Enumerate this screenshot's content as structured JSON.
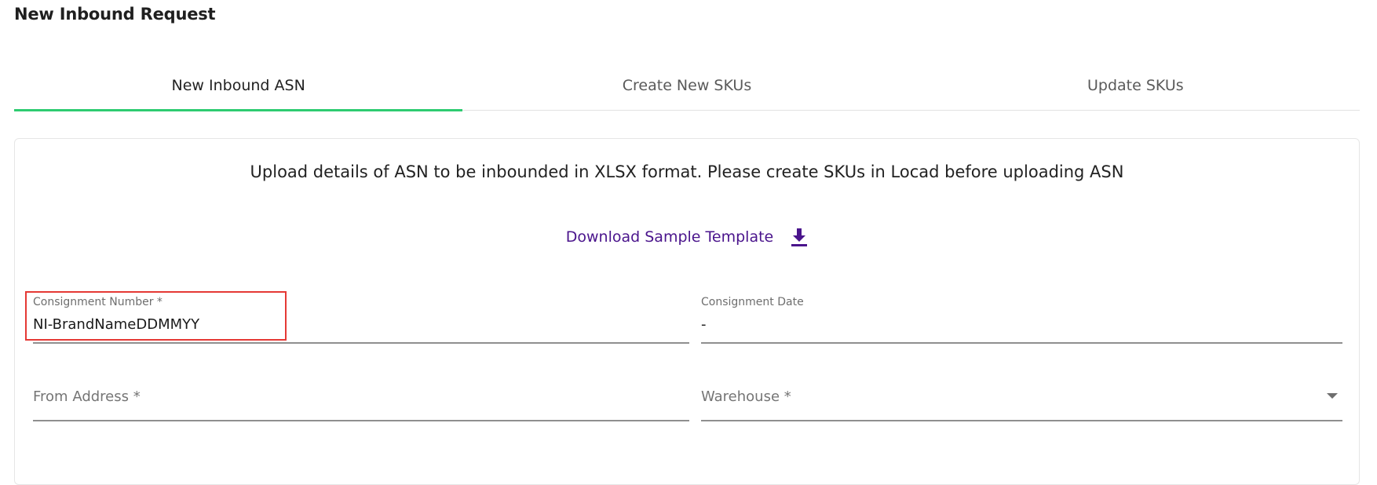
{
  "page": {
    "title": "New Inbound Request"
  },
  "tabs": [
    {
      "label": "New Inbound ASN",
      "active": true
    },
    {
      "label": "Create New SKUs",
      "active": false
    },
    {
      "label": "Update SKUs",
      "active": false
    }
  ],
  "upload_card": {
    "instructions": "Upload details of ASN to be inbounded in XLSX format. Please create SKUs in Locad before uploading ASN",
    "download_label": "Download Sample Template"
  },
  "form": {
    "consignment_number": {
      "label": "Consignment Number  *",
      "value": "NI-BrandNameDDMMYY"
    },
    "consignment_date": {
      "label": "Consignment Date",
      "value": "-"
    },
    "from_address": {
      "placeholder": "From Address *"
    },
    "warehouse": {
      "placeholder": "Warehouse *"
    }
  },
  "colors": {
    "active_tab_indicator": "#2ecc71",
    "link": "#4a148c",
    "highlight": "#e53935"
  }
}
